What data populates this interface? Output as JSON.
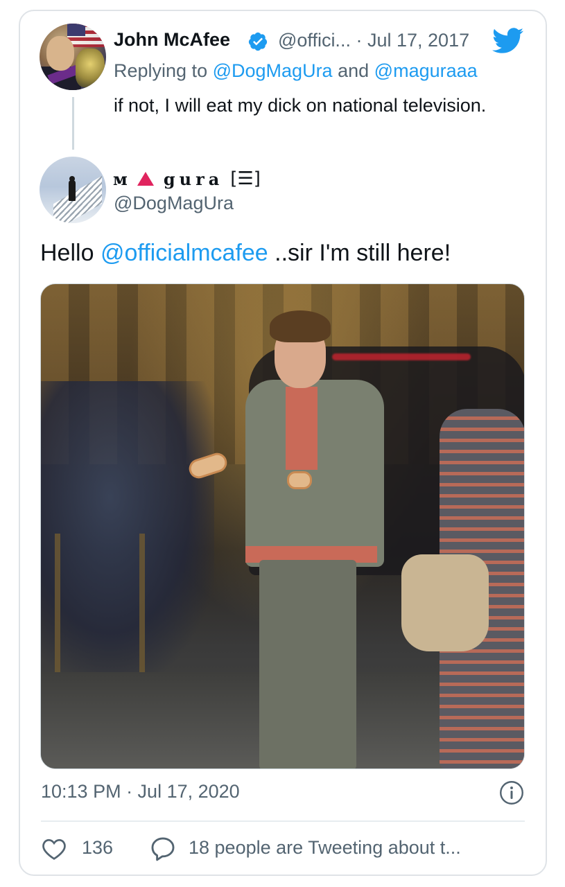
{
  "quoted_tweet": {
    "author_name": "John McAfee",
    "handle": "@offici...",
    "separator": "·",
    "date": "Jul 17, 2017",
    "replying_prefix": "Replying to",
    "replying_user_1": "@DogMagUra",
    "replying_and": "and",
    "replying_user_2": "@maguraaa",
    "text": "if not, I will eat my dick on national television.",
    "icons": {
      "verified": "verified-badge-icon",
      "bird": "twitter-bird-icon"
    }
  },
  "tweet": {
    "display_name": {
      "part1": "ᴍ",
      "part3": "gura",
      "part4": "[☰]"
    },
    "handle": "@DogMagUra",
    "text_before": "Hello ",
    "mention": "@officialmcafee",
    "text_after": " ..sir I'm still here!",
    "timestamp": "10:13 PM · Jul 17, 2020",
    "likes": "136",
    "tweeting_about": "18 people are Tweeting about t...",
    "icons": {
      "info": "info-icon",
      "like": "heart-icon",
      "reply": "speech-bubble-icon"
    }
  },
  "colors": {
    "link": "#1d9bf0",
    "secondary_text": "#536471",
    "primary_text": "#0f1419",
    "border": "#dfe3e7",
    "brand_triangle": "#e0245e"
  }
}
